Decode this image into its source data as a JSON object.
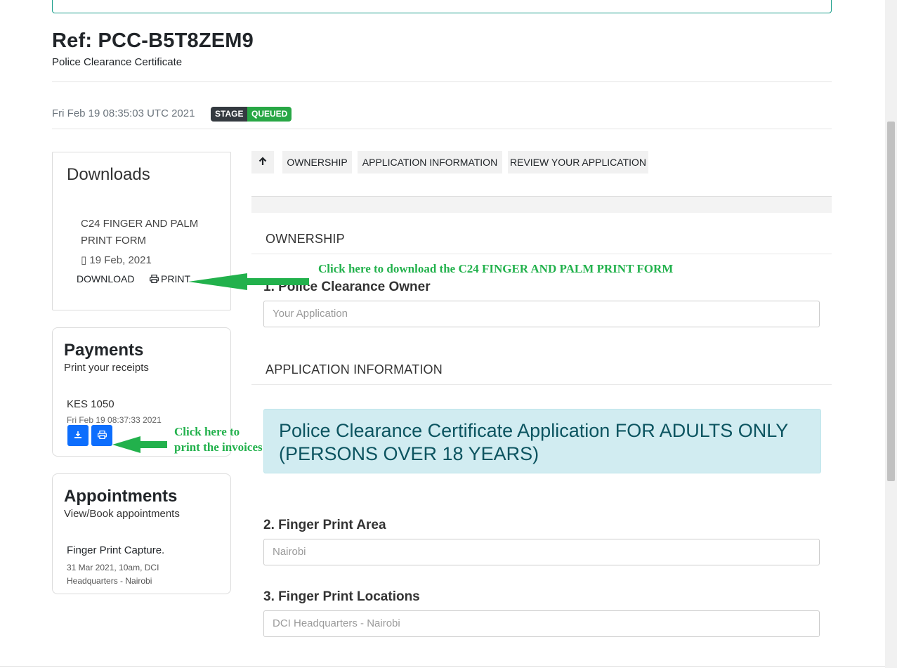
{
  "header": {
    "ref": "Ref: PCC-B5T8ZEM9",
    "subtitle": "Police Clearance Certificate",
    "timestamp": "Fri Feb 19 08:35:03 UTC 2021",
    "stage_label": "STAGE",
    "stage_value": "QUEUED"
  },
  "downloads": {
    "title": "Downloads",
    "form_name": "C24 FINGER AND PALM PRINT FORM",
    "form_date": "▯ 19 Feb, 2021",
    "download_label": "DOWNLOAD",
    "print_label": "PRINT"
  },
  "payments": {
    "title": "Payments",
    "subtitle": "Print your receipts",
    "amount": "KES 1050",
    "time": "Fri Feb 19 08:37:33 2021"
  },
  "appointments": {
    "title": "Appointments",
    "subtitle": "View/Book appointments",
    "name": "Finger Print Capture.",
    "details": "31 Mar 2021, 10am, DCI Headquarters - Nairobi"
  },
  "tabs": {
    "up_icon": "↑",
    "items": [
      "OWNERSHIP",
      "APPLICATION INFORMATION",
      "REVIEW YOUR APPLICATION"
    ]
  },
  "form": {
    "section_ownership": "OWNERSHIP",
    "q1_label": "1. Police Clearance Owner",
    "q1_value": "Your Application",
    "section_appinfo": "APPLICATION INFORMATION",
    "alert_text": "Police Clearance Certificate Application FOR ADULTS ONLY (PERSONS OVER 18 YEARS)",
    "q2_label": "2. Finger Print Area",
    "q2_value": "Nairobi",
    "q3_label": "3. Finger Print Locations",
    "q3_value": "DCI Headquarters - Nairobi"
  },
  "annotations": {
    "download_hint": "Click here to download the C24 FINGER AND PALM PRINT FORM",
    "print_hint_1": "Click here to",
    "print_hint_2": "print the invoices"
  },
  "colors": {
    "accent_green": "#22b14c",
    "badge_dark": "#343a40",
    "badge_green": "#28a745",
    "button_blue": "#0d6efd",
    "alert_bg": "#d1ecf1"
  }
}
